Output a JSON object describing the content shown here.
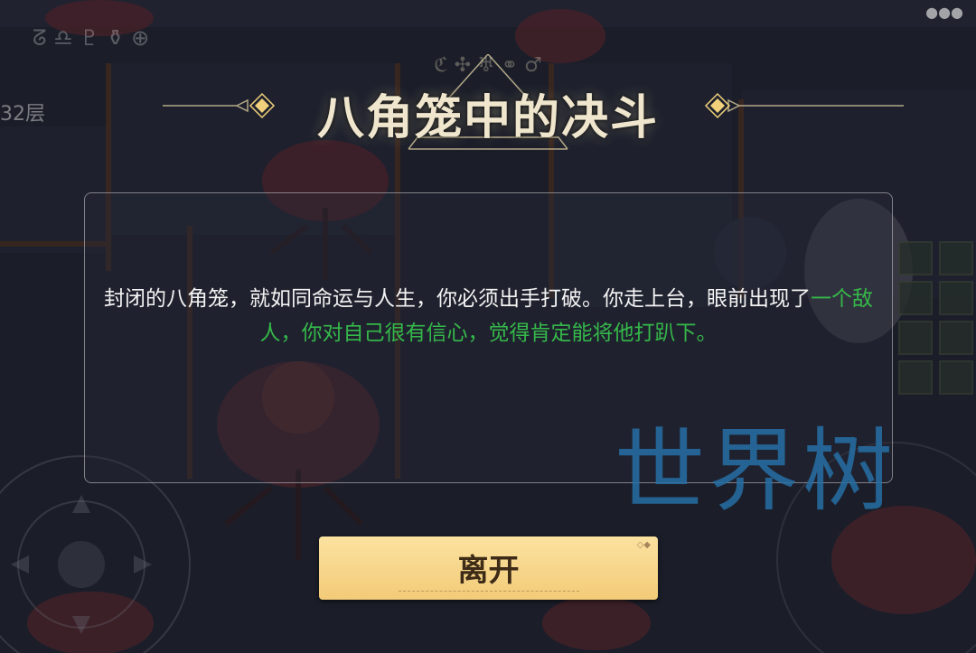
{
  "dialog": {
    "title": "八角笼中的决斗",
    "title_runes": "ℭ ✣ ♅ ⚭ ♂",
    "description_white_1": "封闭的八角笼，就如同命运与人生，你必须出手打破。你走上台，眼前出现了",
    "description_green": "一个敌人，你对自己很有信心，觉得肯定能将他打趴下。",
    "leave_button": "离开"
  },
  "hud": {
    "floor_label": "32层",
    "rune_row": "ᘔ ♎ ♇ ⚱ ⊕",
    "menu_icon": "menu-dots-icon"
  },
  "watermark": "世界树",
  "colors": {
    "highlight_green": "#35b84a",
    "button_gold": "#f6d080",
    "title_cream": "#efe6cd",
    "watermark_blue": "#266ea5"
  }
}
